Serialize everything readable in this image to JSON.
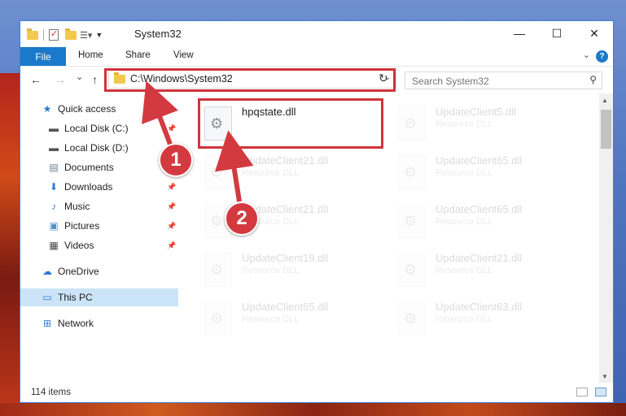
{
  "window": {
    "title": "System32",
    "minimize": "—",
    "maximize": "☐",
    "close": "✕"
  },
  "ribbon": {
    "tabs": [
      "File",
      "Home",
      "Share",
      "View"
    ],
    "help": "?"
  },
  "nav": {
    "back": "←",
    "forward": "→",
    "recent": "⌄",
    "up": "↑",
    "address": "C:\\Windows\\System32",
    "refresh": "↻",
    "search_placeholder": "Search System32"
  },
  "sidebar": {
    "items": [
      {
        "label": "Quick access",
        "icon": "star-icon"
      },
      {
        "label": "Local Disk (C:)",
        "icon": "drive-icon",
        "pinned": true
      },
      {
        "label": "Local Disk (D:)",
        "icon": "drive-icon",
        "pinned": false
      },
      {
        "label": "Documents",
        "icon": "documents-icon",
        "pinned": true
      },
      {
        "label": "Downloads",
        "icon": "downloads-icon",
        "pinned": true
      },
      {
        "label": "Music",
        "icon": "music-icon",
        "pinned": true
      },
      {
        "label": "Pictures",
        "icon": "pictures-icon",
        "pinned": true
      },
      {
        "label": "Videos",
        "icon": "videos-icon",
        "pinned": true
      },
      {
        "label": "OneDrive",
        "icon": "cloud-icon"
      },
      {
        "label": "This PC",
        "icon": "computer-icon",
        "selected": true
      },
      {
        "label": "Network",
        "icon": "network-icon"
      }
    ]
  },
  "files": [
    {
      "name": "hpqstate.dll",
      "type": ""
    },
    {
      "name": "UpdateClient5.dll",
      "type": "Resource DLL"
    },
    {
      "name": "UpdateClient21.dll",
      "type": "Resource DLL"
    },
    {
      "name": "UpdateClient65.dll",
      "type": "Resource DLL"
    },
    {
      "name": "UpdateClient21.dll",
      "type": "Resource DLL"
    },
    {
      "name": "UpdateClient65.dll",
      "type": "Resource DLL"
    },
    {
      "name": "UpdateClient19.dll",
      "type": "Resource DLL"
    },
    {
      "name": "UpdateClient21.dll",
      "type": "Resource DLL"
    },
    {
      "name": "UpdateClient65.dll",
      "type": "Resource DLL"
    },
    {
      "name": "UpdateClient63.dll",
      "type": "Resource DLL"
    }
  ],
  "status": {
    "count": "114 items"
  },
  "callouts": [
    "1",
    "2"
  ],
  "colors": {
    "accent": "#1979ca",
    "highlight": "#d0333b",
    "selection": "#cce4f7"
  }
}
